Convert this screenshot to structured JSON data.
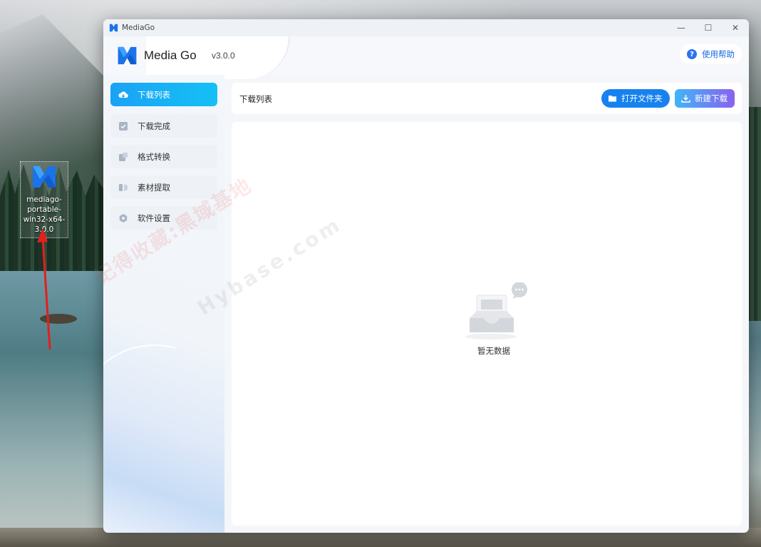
{
  "desktop": {
    "icon_label": "mediago-portable-win32-x64-3.0.0",
    "icon_name": "mediago-app-icon"
  },
  "window": {
    "title": "MediaGo",
    "controls": {
      "minimize": "—",
      "maximize": "☐",
      "close": "✕"
    }
  },
  "header": {
    "app_name": "Media Go",
    "version": "v3.0.0",
    "help_label": "使用帮助",
    "help_icon": "?"
  },
  "sidebar": {
    "items": [
      {
        "label": "下载列表",
        "icon": "cloud-download-icon",
        "active": true
      },
      {
        "label": "下载完成",
        "icon": "check-box-icon",
        "active": false
      },
      {
        "label": "格式转换",
        "icon": "convert-icon",
        "active": false
      },
      {
        "label": "素材提取",
        "icon": "extract-icon",
        "active": false
      },
      {
        "label": "软件设置",
        "icon": "settings-icon",
        "active": false
      }
    ]
  },
  "toolbar": {
    "title": "下载列表",
    "open_folder_label": "打开文件夹",
    "new_download_label": "新建下载"
  },
  "content": {
    "empty_text": "暂无数据"
  },
  "watermark": {
    "text": "记得收藏:黑域基地",
    "site": "Hybase.com"
  },
  "colors": {
    "accent": "#1677ff",
    "active_nav": "#16b2f5",
    "open_button": "#1782ef",
    "new_button_gradient": [
      "#3fb5f8",
      "#8a62ee"
    ]
  }
}
